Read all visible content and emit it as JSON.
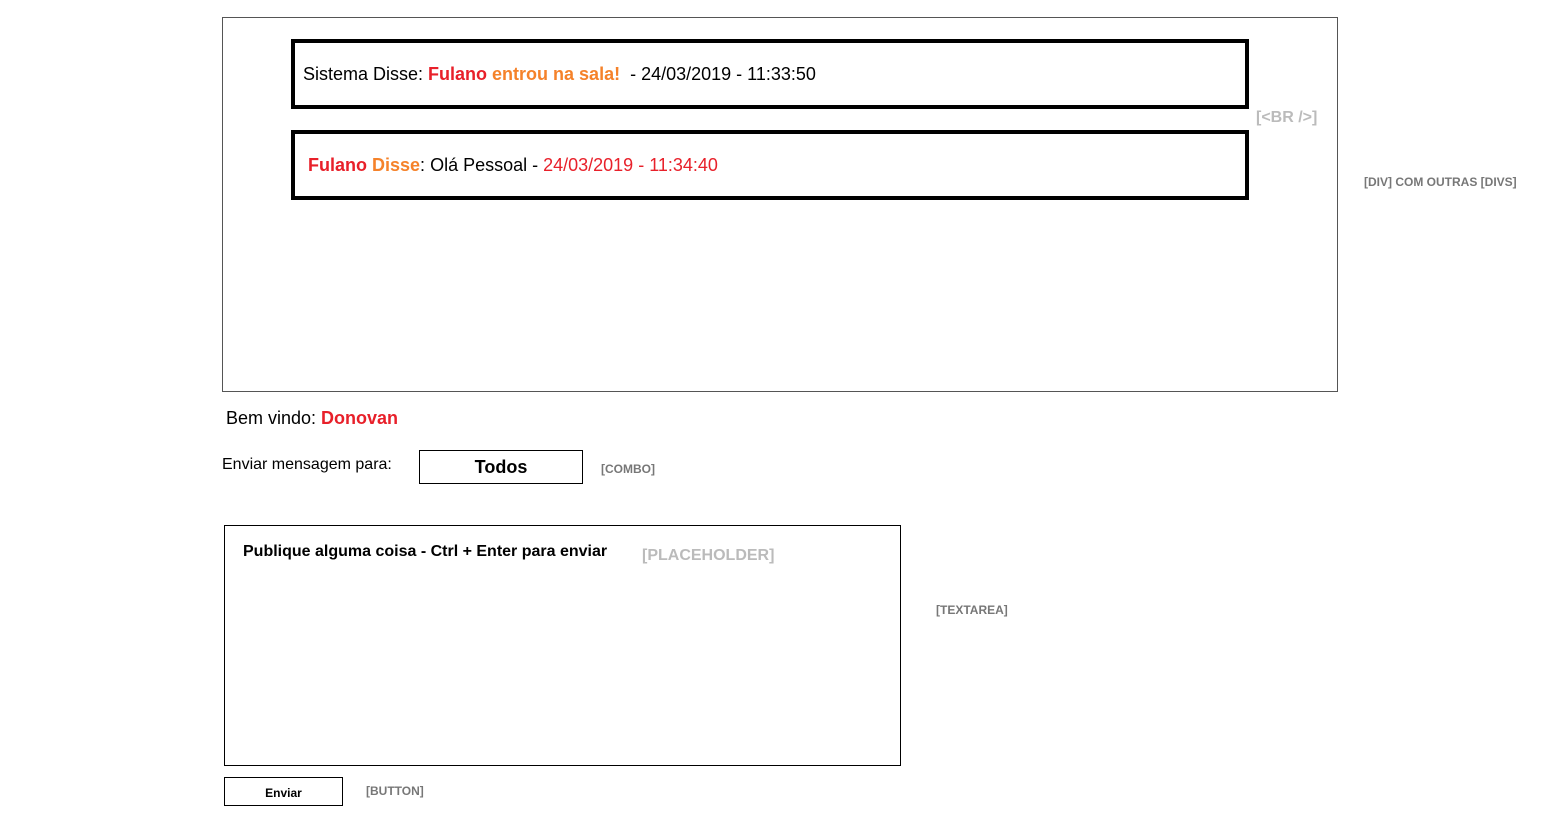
{
  "chat": {
    "messages": [
      {
        "prefix": "Sistema Disse: ",
        "name": "Fulano",
        "text": " entrou na sala!",
        "stamp": "  - 24/03/2019 - 11:33:50"
      },
      {
        "name": "Fulano",
        "disse": " Disse",
        "sep": ": ",
        "text": "Olá Pessoal - ",
        "stamp": "24/03/2019 - 11:34:40"
      }
    ],
    "br_note": "[<BR />]",
    "div_note": "[DIV] COM OUTRAS [DIVS]"
  },
  "welcome": {
    "label": "Bem vindo: ",
    "user": "Donovan"
  },
  "recipient": {
    "label": "Enviar mensagem para:",
    "value": "Todos",
    "note": "[COMBO]"
  },
  "composer": {
    "placeholder": "Publique alguma coisa - Ctrl + Enter para enviar",
    "placeholder_note": "[PLACEHOLDER]",
    "note": "[TEXTAREA]"
  },
  "send": {
    "label": "Enviar",
    "note": "[BUTTON]"
  },
  "colors": {
    "red": "#e8202a",
    "orange": "#f5822a"
  }
}
